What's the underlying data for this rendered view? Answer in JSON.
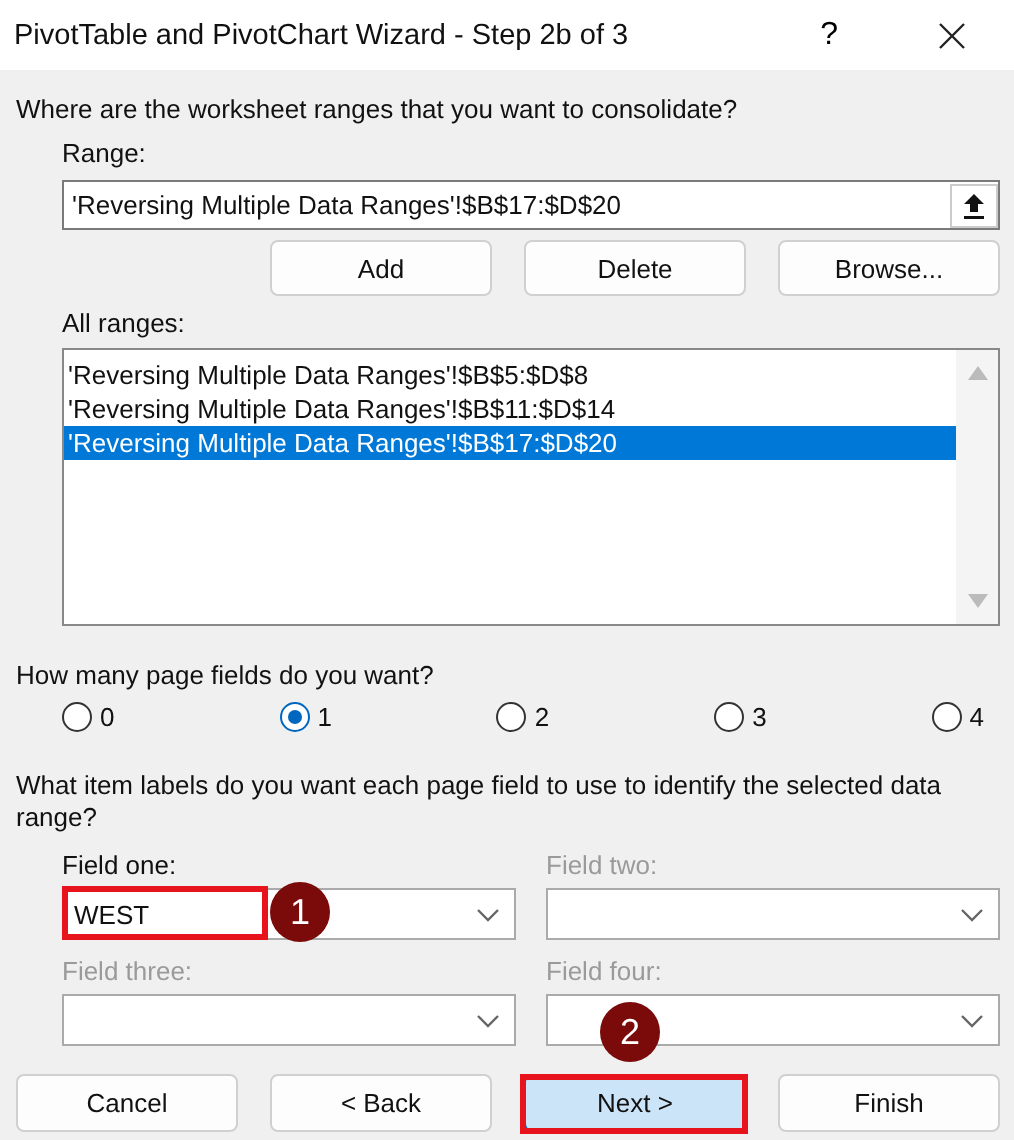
{
  "window": {
    "title": "PivotTable and PivotChart Wizard - Step 2b of 3",
    "help_button": "?"
  },
  "ranges_prompt": "Where are the worksheet ranges that you want to consolidate?",
  "range": {
    "label": "Range:",
    "value": "'Reversing Multiple Data Ranges'!$B$17:$D$20"
  },
  "range_buttons": [
    {
      "label": "Add"
    },
    {
      "label": "Delete"
    },
    {
      "label": "Browse..."
    }
  ],
  "all_ranges": {
    "label": "All ranges:",
    "items": [
      {
        "text": "'Reversing Multiple Data Ranges'!$B$5:$D$8",
        "selected": false
      },
      {
        "text": "'Reversing Multiple Data Ranges'!$B$11:$D$14",
        "selected": false
      },
      {
        "text": "'Reversing Multiple Data Ranges'!$B$17:$D$20",
        "selected": true
      }
    ]
  },
  "page_fields_prompt": "How many page fields do you want?",
  "page_field_options": [
    {
      "label": "0",
      "selected": false
    },
    {
      "label": "1",
      "selected": true
    },
    {
      "label": "2",
      "selected": false
    },
    {
      "label": "3",
      "selected": false
    },
    {
      "label": "4",
      "selected": false
    }
  ],
  "labels_prompt": "What item labels do you want each page field to use to identify the selected data range?",
  "fields": [
    {
      "label": "Field one:",
      "value": "WEST",
      "disabled": false,
      "highlighted": true,
      "callout": "1"
    },
    {
      "label": "Field two:",
      "disabled": true,
      "highlighted": false
    },
    {
      "label": "Field three:",
      "disabled": true,
      "highlighted": false
    },
    {
      "label": "Field four:",
      "disabled": true,
      "highlighted": false
    }
  ],
  "buttons": [
    {
      "label": "Cancel",
      "default": false,
      "highlighted": false
    },
    {
      "label": "< Back",
      "default": false,
      "highlighted": false
    },
    {
      "label": "Next >",
      "default": true,
      "highlighted": true,
      "callout": "2"
    },
    {
      "label": "Finish",
      "default": false,
      "highlighted": false
    }
  ]
}
